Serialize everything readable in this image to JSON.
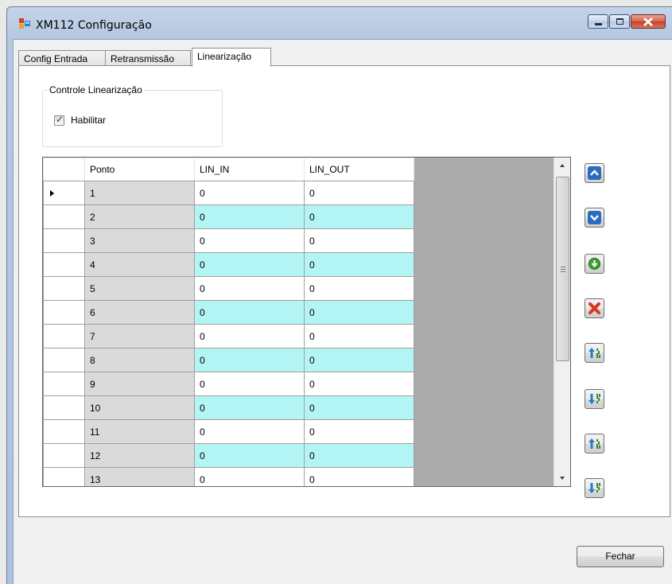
{
  "window": {
    "title": "XM112 Configuração"
  },
  "tabs": [
    {
      "label": "Config Entrada"
    },
    {
      "label": "Retransmissão"
    },
    {
      "label": "Linearização"
    }
  ],
  "linearizacao": {
    "group_title": "Controle Linearização",
    "habilitar_label": "Habilitar",
    "habilitar_checked": true,
    "columns": [
      "Ponto",
      "LIN_IN",
      "LIN_OUT"
    ],
    "rows": [
      {
        "ponto": "1",
        "lin_in": "0",
        "lin_out": "0"
      },
      {
        "ponto": "2",
        "lin_in": "0",
        "lin_out": "0"
      },
      {
        "ponto": "3",
        "lin_in": "0",
        "lin_out": "0"
      },
      {
        "ponto": "4",
        "lin_in": "0",
        "lin_out": "0"
      },
      {
        "ponto": "5",
        "lin_in": "0",
        "lin_out": "0"
      },
      {
        "ponto": "6",
        "lin_in": "0",
        "lin_out": "0"
      },
      {
        "ponto": "7",
        "lin_in": "0",
        "lin_out": "0"
      },
      {
        "ponto": "8",
        "lin_in": "0",
        "lin_out": "0"
      },
      {
        "ponto": "9",
        "lin_in": "0",
        "lin_out": "0"
      },
      {
        "ponto": "10",
        "lin_in": "0",
        "lin_out": "0"
      },
      {
        "ponto": "11",
        "lin_in": "0",
        "lin_out": "0"
      },
      {
        "ponto": "12",
        "lin_in": "0",
        "lin_out": "0"
      },
      {
        "ponto": "13",
        "lin_in": "0",
        "lin_out": "0"
      }
    ],
    "side_buttons": [
      {
        "icon": "arrow-up-icon"
      },
      {
        "icon": "arrow-down-icon"
      },
      {
        "icon": "add-green-icon"
      },
      {
        "icon": "delete-red-x-icon"
      },
      {
        "icon": "sort-ascending-icon"
      },
      {
        "icon": "sort-descending-icon"
      },
      {
        "icon": "sort-ascending-icon"
      },
      {
        "icon": "sort-descending-icon"
      }
    ]
  },
  "footer": {
    "close_label": "Fechar"
  },
  "colors": {
    "alt_row": "#b3f5f5",
    "ponto_cell": "#dadada",
    "grid_background": "#ababab",
    "close_button_red": "#c2412a"
  }
}
